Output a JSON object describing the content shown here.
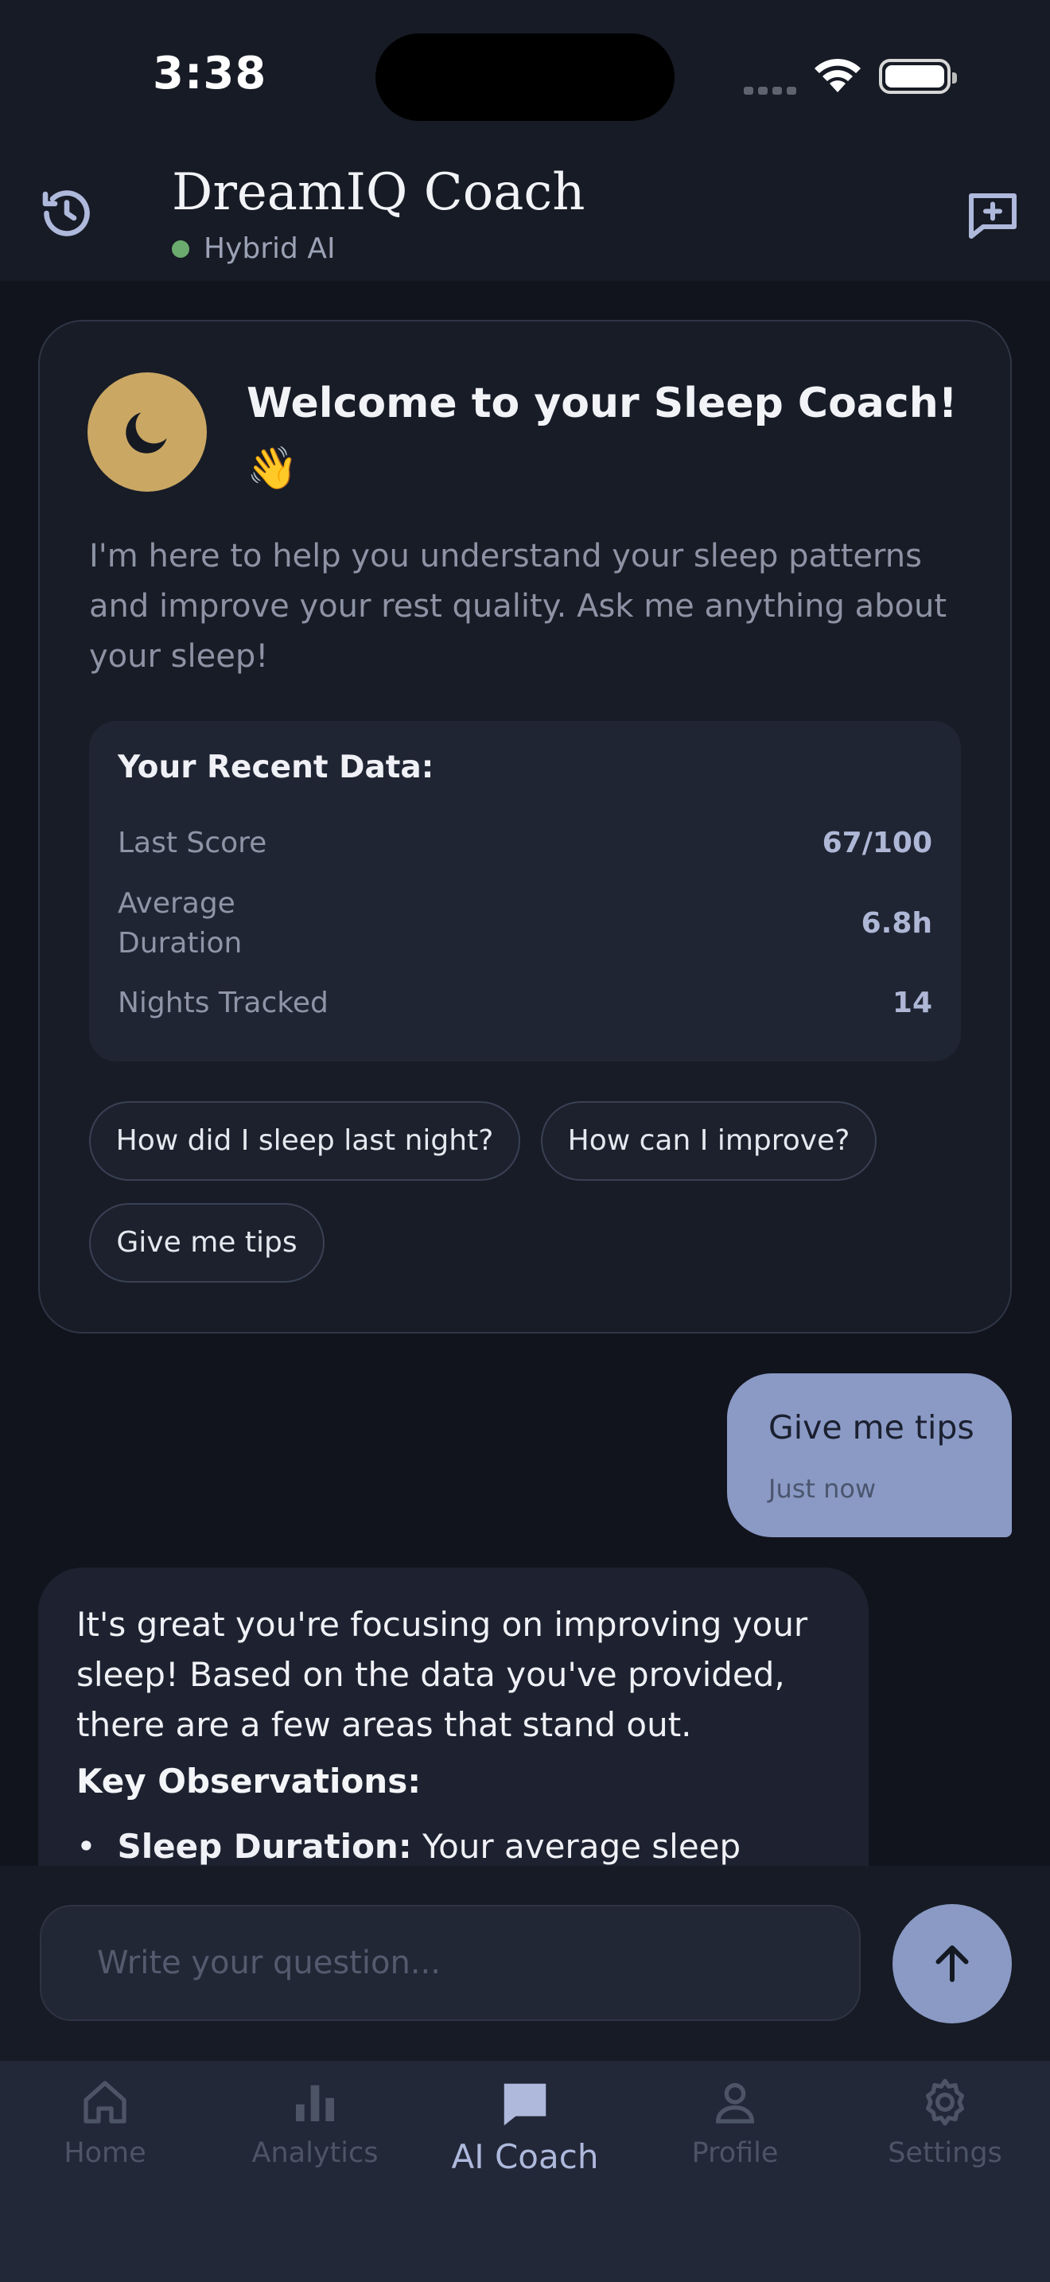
{
  "status_bar": {
    "time": "3:38"
  },
  "header": {
    "title": "DreamIQ Coach",
    "mode": "Hybrid AI",
    "history_icon": "history-icon",
    "new_chat_icon": "new-chat-icon"
  },
  "welcome": {
    "title": "Welcome to your Sleep Coach! 👋",
    "text": "I'm here to help you understand your sleep patterns and improve your rest quality. Ask me anything about your sleep!",
    "recent": {
      "title": "Your Recent Data:",
      "rows": [
        {
          "label": "Last Score",
          "value": "67/100"
        },
        {
          "label": "Average Duration",
          "value": "6.8h"
        },
        {
          "label": "Nights Tracked",
          "value": "14"
        }
      ]
    },
    "suggestions": [
      "How did I sleep last night?",
      "How can I improve?",
      "Give me tips"
    ]
  },
  "messages": {
    "user": {
      "text": "Give me tips",
      "time": "Just now"
    },
    "ai": {
      "text": "It's great you're focusing on improving your sleep! Based on the data you've provided, there are a few areas that stand out.",
      "heading": "Key Observations:",
      "bullet_label": "Sleep Duration:",
      "bullet_text": " Your average sleep"
    }
  },
  "input": {
    "placeholder": "Write your question..."
  },
  "tabs": [
    {
      "label": "Home",
      "icon": "home-icon"
    },
    {
      "label": "Analytics",
      "icon": "bar-chart-icon"
    },
    {
      "label": "AI Coach",
      "icon": "chat-icon",
      "active": true
    },
    {
      "label": "Profile",
      "icon": "person-icon"
    },
    {
      "label": "Settings",
      "icon": "gear-icon"
    }
  ],
  "colors": {
    "background": "#11141d",
    "accent": "#8a9ac5",
    "gold": "#caa864",
    "online": "#6bab6e"
  }
}
